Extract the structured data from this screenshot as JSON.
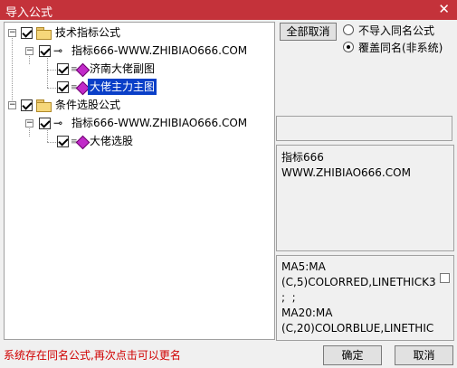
{
  "window": {
    "title": "导入公式",
    "close_glyph": "✕"
  },
  "tree": {
    "nodes": [
      {
        "label": "技术指标公式"
      },
      {
        "label": "指标666-WWW.ZHIBIAO666.COM"
      },
      {
        "label": "济南大佬副图"
      },
      {
        "label": "大佬主力主图",
        "selected": true
      },
      {
        "label": "条件选股公式"
      },
      {
        "label": "指标666-WWW.ZHIBIAO666.COM"
      },
      {
        "label": "大佬选股"
      }
    ]
  },
  "options": {
    "cancel_all": "全部取消",
    "radio_no_import": "不导入同名公式",
    "radio_overwrite": "覆盖同名(非系统)",
    "selected": "radio_overwrite"
  },
  "info_panel": {
    "text": "指标666\nWWW.ZHIBIAO666.COM"
  },
  "code_panel": {
    "text": "MA5:MA\n(C,5)COLORRED,LINETHICK3\n;  ;\nMA20:MA\n(C,20)COLORBLUE,LINETHIC"
  },
  "footer": {
    "status": "系统存在同名公式,再次点击可以更名",
    "ok": "确定",
    "cancel": "取消"
  }
}
